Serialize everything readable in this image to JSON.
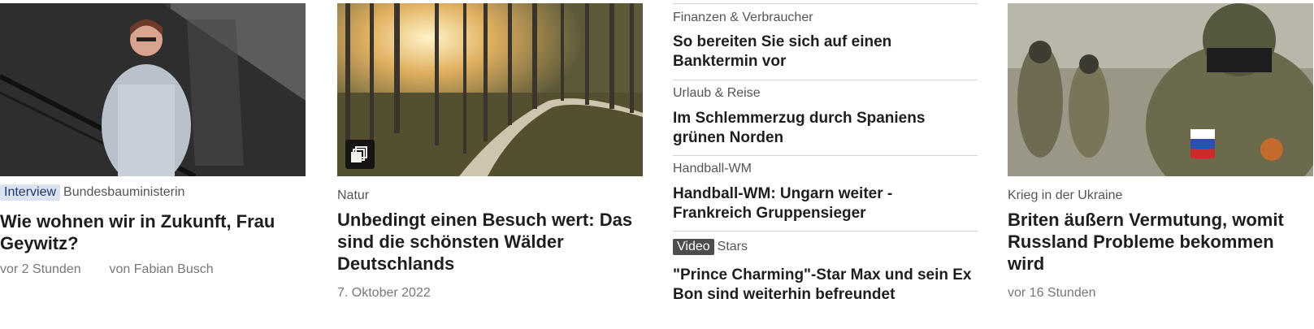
{
  "cards": [
    {
      "tag": "Interview",
      "kicker": "Bundesbauministerin",
      "headline": "Wie wohnen wir in Zukunft, Frau Geywitz?",
      "time": "vor 2 Stunden",
      "author": "von Fabian Busch"
    },
    {
      "kicker": "Natur",
      "headline": "Unbedingt einen Besuch wert: Das sind die schönsten Wälder Deutschlands",
      "date": "7. Oktober 2022",
      "icon": "gallery-icon"
    },
    {
      "items": [
        {
          "kicker": "Finanzen & Verbraucher",
          "title": "So bereiten Sie sich auf einen Banktermin vor"
        },
        {
          "kicker": "Urlaub & Reise",
          "title": "Im Schlemmerzug durch Spaniens grünen Norden"
        },
        {
          "kicker": "Handball-WM",
          "title": "Handball-WM: Ungarn weiter - Frankreich Gruppensieger"
        },
        {
          "tag": "Video",
          "kicker": "Stars",
          "title": "\"Prince Charming\"-Star Max und sein Ex Bon sind weiterhin befreundet"
        }
      ]
    },
    {
      "kicker": "Krieg in der Ukraine",
      "headline": "Briten äußern Vermutung, womit Russland Probleme bekommen wird",
      "time": "vor 16 Stunden"
    }
  ],
  "colors": {
    "interview_tag_bg": "#dbe3f1",
    "video_tag_bg": "#4d4d4d",
    "headline": "#1e1e1e",
    "meta": "#777777"
  }
}
